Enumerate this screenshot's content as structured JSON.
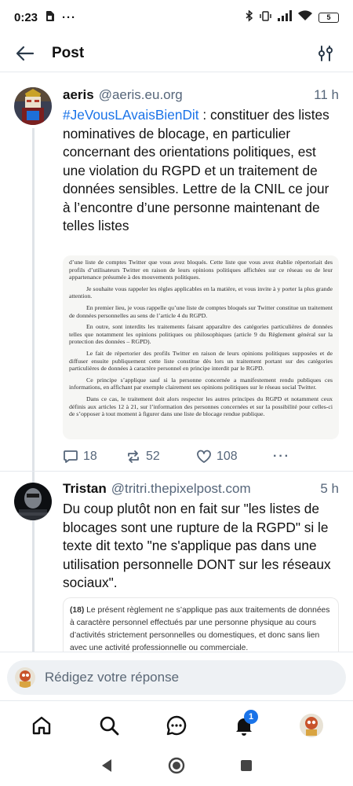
{
  "status_bar": {
    "time": "0:23",
    "battery": "5"
  },
  "header": {
    "title": "Post"
  },
  "posts": [
    {
      "author": "aeris",
      "handle": "@aeris.eu.org",
      "time": "11 h",
      "hashtag": "#JeVousLAvaisBienDit",
      "text": " : constituer des listes nominatives de blocage, en particulier concernant des orientations politiques, est une violation du RGPD et un traitement de données sensibles. Lettre de la CNIL ce jour à l’encontre d’une personne maintenant de telles listes",
      "document": [
        "d’une liste de comptes Twitter que vous avez bloqués. Cette liste que vous avez établie répertoriait des profils d’utilisateurs Twitter en raison de leurs opinions politiques affichées sur ce réseau ou de leur appartenance présumée à des mouvements politiques.",
        "Je souhaite vous rappeler les règles applicables en la matière, et vous invite à y porter la plus grande attention.",
        "En premier lieu, je vous rappelle qu’une liste de comptes bloqués sur Twitter constitue un traitement de données personnelles au sens de l’article 4 du RGPD.",
        "En outre, sont interdits les traitements faisant apparaître des catégories particulières de données telles que notamment les opinions politiques ou philosophiques (article 9 du Règlement général sur la protection des données – RGPD).",
        "Le fait de répertorier des profils Twitter en raison de leurs opinions politiques supposées et de diffuser ensuite publiquement cette liste constitue dès lors un traitement portant sur des catégories particulières de données à caractère personnel en principe interdit par le RGPD.",
        "Ce principe s’applique sauf si la personne concernée a manifestement rendu publiques ces informations, en affichant par exemple clairement ses opinions politiques sur le réseau social Twitter.",
        "Dans ce cas, le traitement doit alors respecter les autres principes du RGPD et notamment ceux définis aux articles 12 à 21, sur l’information des personnes concernées et sur la possibilité pour celles-ci de s’opposer à tout moment à figurer dans une liste de blocage rendue publique."
      ],
      "replies": "18",
      "reposts": "52",
      "likes": "108"
    },
    {
      "author": "Tristan",
      "handle": "@tritri.thepixelpost.com",
      "time": "5 h",
      "text": "Du coup plutôt non en fait sur \"les listes de blocages sont une rupture de la RGPD\" si le texte dit texto \"ne s'applique pas dans une utilisation personnelle DONT sur les réseaux sociaux\".",
      "quote_number": "(18)",
      "quote_text": " Le présent règlement ne s’applique pas aux traitements de données à caractère personnel effectués par une personne physique au cours d’activités strictement personnelles ou domestiques, et donc sans lien avec une activité professionnelle ou commerciale."
    }
  ],
  "composer": {
    "placeholder": "Rédigez votre réponse"
  },
  "tab_bar": {
    "notifications_badge": "1"
  },
  "colors": {
    "accent": "#1a73e8",
    "muted_text": "#56667a",
    "thread_line": "#dfe3e8",
    "composer_bg": "#eef1f4"
  }
}
